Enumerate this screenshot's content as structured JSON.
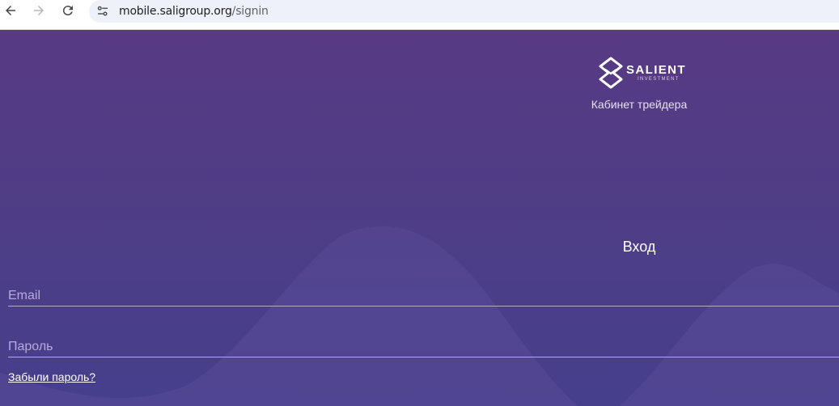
{
  "browser": {
    "url_host": "mobile.saligroup.org",
    "url_path": "/signin",
    "icons": {
      "back": "arrow-left-icon",
      "forward": "arrow-right-icon",
      "reload": "reload-icon",
      "site_info": "tune-icon"
    }
  },
  "brand": {
    "logo_name": "SALIENT",
    "logo_sub": "INVESTMENT",
    "cabinet_title": "Кабинет трейдера"
  },
  "login": {
    "heading": "Вход",
    "email_placeholder": "Email",
    "password_placeholder": "Пароль",
    "forgot_password": "Забыли пароль?"
  },
  "colors": {
    "background_top": "#583a84",
    "background_bottom": "#463f8c",
    "wave": "#5a4b98",
    "field_line": "#b6a9d7",
    "placeholder": "#b9a9dd"
  }
}
